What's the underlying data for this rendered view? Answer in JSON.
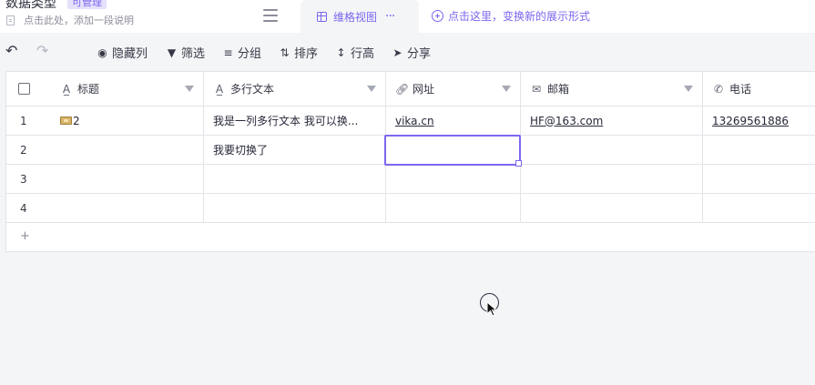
{
  "header": {
    "sheet_title": "数据类型",
    "permission_badge": "可管理",
    "description_placeholder": "点击此处，添加一段说明",
    "active_view": {
      "label": "维格视图",
      "more": "···"
    },
    "add_view_label": "点击这里，变换新的展示形式"
  },
  "toolbar": {
    "hide_columns": "隐藏列",
    "filter": "筛选",
    "group": "分组",
    "sort": "排序",
    "row_height": "行高",
    "share": "分享"
  },
  "table": {
    "columns": [
      {
        "label": "标题",
        "icon": "text-field-icon"
      },
      {
        "label": "多行文本",
        "icon": "text-field-icon"
      },
      {
        "label": "网址",
        "icon": "link-icon"
      },
      {
        "label": "邮箱",
        "icon": "mail-icon"
      },
      {
        "label": "电话",
        "icon": "phone-icon"
      }
    ],
    "rows": [
      {
        "num": "1",
        "title": "2",
        "multiline": "我是一列多行文本 我可以换...",
        "url": "vika.cn",
        "email": "HF@163.com",
        "phone": "13269561886"
      },
      {
        "num": "2",
        "title": "",
        "multiline": "我要切换了",
        "url": "",
        "email": "",
        "phone": ""
      },
      {
        "num": "3",
        "title": "",
        "multiline": "",
        "url": "",
        "email": "",
        "phone": ""
      },
      {
        "num": "4",
        "title": "",
        "multiline": "",
        "url": "",
        "email": "",
        "phone": ""
      }
    ],
    "add_row_symbol": "+"
  },
  "colors": {
    "accent": "#7b67ee",
    "border": "#e3e4e8",
    "background": "#f4f5f7"
  }
}
